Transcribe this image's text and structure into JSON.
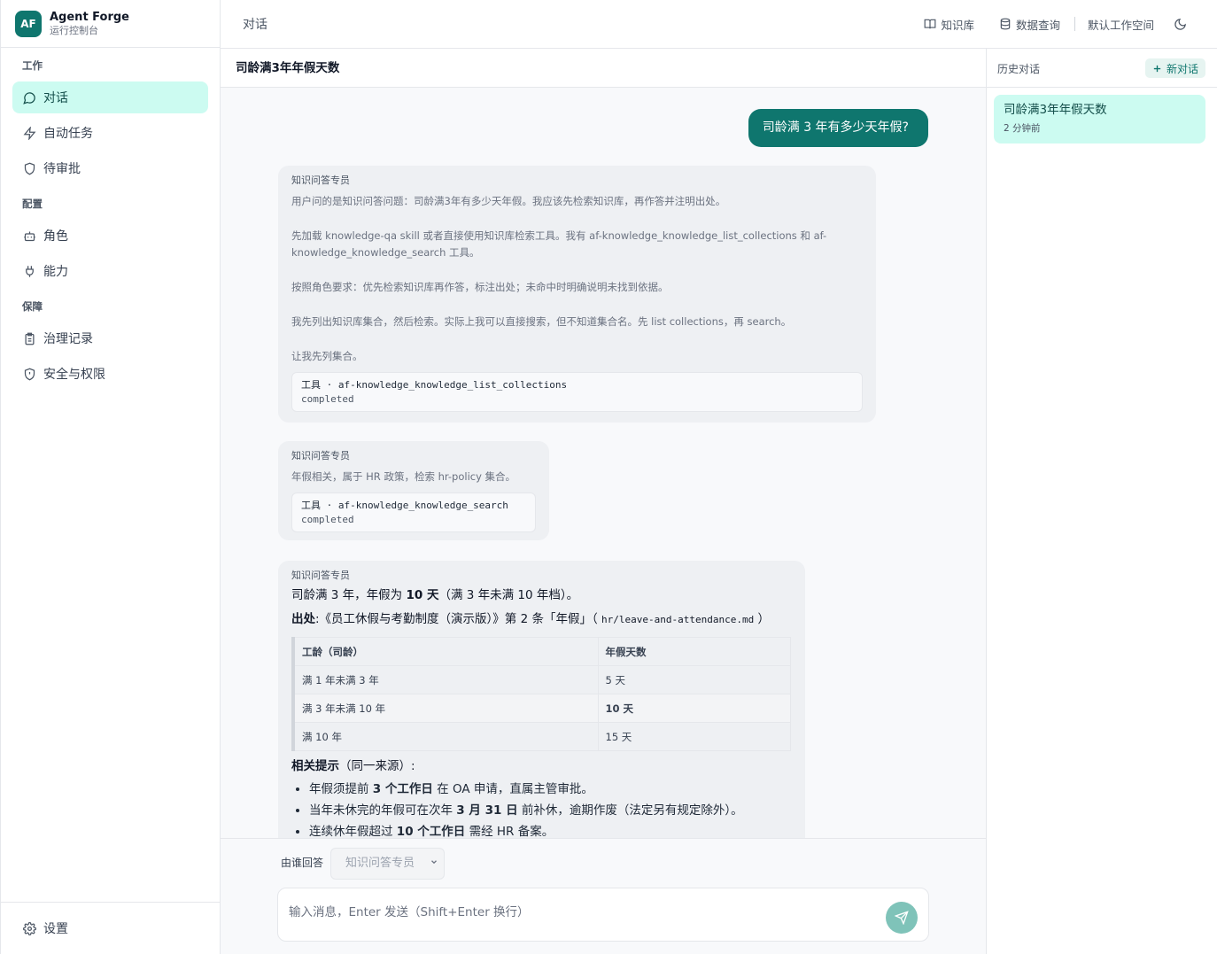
{
  "brand": {
    "logo": "AF",
    "name": "Agent Forge",
    "subtitle": "运行控制台"
  },
  "sidebar": {
    "sections": [
      {
        "title": "工作",
        "items": [
          {
            "label": "对话",
            "icon": "chat-bubble-icon",
            "active": true
          },
          {
            "label": "自动任务",
            "icon": "lightning-icon"
          },
          {
            "label": "待审批",
            "icon": "shield-icon"
          }
        ]
      },
      {
        "title": "配置",
        "items": [
          {
            "label": "角色",
            "icon": "bot-icon"
          },
          {
            "label": "能力",
            "icon": "plug-icon"
          }
        ]
      },
      {
        "title": "保障",
        "items": [
          {
            "label": "治理记录",
            "icon": "clipboard-icon"
          },
          {
            "label": "安全与权限",
            "icon": "shield-alert-icon"
          }
        ]
      }
    ],
    "footer": {
      "label": "设置",
      "icon": "gear-icon"
    }
  },
  "header": {
    "title": "对话",
    "actions": {
      "knowledge": "知识库",
      "data_query": "数据查询",
      "workspace": "默认工作空间"
    }
  },
  "conversation": {
    "title": "司龄满3年年假天数",
    "user_message": "司龄满 3 年有多少天年假?",
    "agent_name": "知识问答专员",
    "thinking_1": [
      "用户问的是知识问答问题：司龄满3年有多少天年假。我应该先检索知识库，再作答并注明出处。",
      "先加载 knowledge-qa skill 或者直接使用知识库检索工具。我有 af-knowledge_knowledge_list_collections 和 af-knowledge_knowledge_search 工具。",
      "按照角色要求：优先检索知识库再作答，标注出处；未命中时明确说明未找到依据。",
      "我先列出知识库集合，然后检索。实际上我可以直接搜索，但不知道集合名。先 list collections，再 search。",
      "让我先列集合。"
    ],
    "tool_1": {
      "name": "工具 · af-knowledge_knowledge_list_collections",
      "status": "completed"
    },
    "thinking_2": "年假相关，属于 HR 政策，检索 hr-policy 集合。",
    "tool_2": {
      "name": "工具 · af-knowledge_knowledge_search",
      "status": "completed"
    },
    "answer": {
      "line1_prefix": "司龄满 3 年，年假为 ",
      "line1_bold": "10 天",
      "line1_suffix": "（满 3 年未满 10 年档）。",
      "source_label": "出处",
      "source_text": ":《员工休假与考勤制度（演示版）》第 2 条「年假」（ ",
      "source_file": "hr/leave-and-attendance.md",
      "source_end": " ）",
      "table_headers": [
        "工龄（司龄）",
        "年假天数"
      ],
      "table_rows": [
        [
          "满 1 年未满 3 年",
          "5 天"
        ],
        [
          "满 3 年未满 10 年",
          "10 天"
        ],
        [
          "满 10 年",
          "15 天"
        ]
      ],
      "hints_label": "相关提示",
      "hints_suffix": "（同一来源）:",
      "hints": [
        {
          "pre": "年假须提前 ",
          "bold": "3 个工作日",
          "post": " 在 OA 申请，直属主管审批。"
        },
        {
          "pre": "当年未休完的年假可在次年 ",
          "bold": "3 月 31 日",
          "post": " 前补休，逾期作废（法定另有规定除外）。"
        },
        {
          "pre": "连续休年假超过 ",
          "bold": "10 个工作日",
          "post": " 需经 HR 备案。"
        }
      ]
    }
  },
  "composer": {
    "who_label": "由谁回答",
    "who_selected": "知识问答专员",
    "placeholder": "输入消息，Enter 发送（Shift+Enter 换行）"
  },
  "history": {
    "title": "历史对话",
    "new_label": "新对话",
    "items": [
      {
        "title": "司龄满3年年假天数",
        "time": "2 分钟前"
      }
    ]
  },
  "colors": {
    "accent": "#0f766e",
    "active_bg": "#ccfbf1"
  }
}
